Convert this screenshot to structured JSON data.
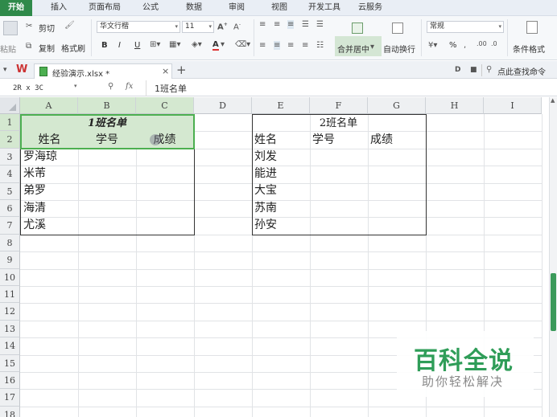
{
  "menu": {
    "items": [
      "开始",
      "插入",
      "页面布局",
      "公式",
      "数据",
      "审阅",
      "视图",
      "开发工具",
      "云服务"
    ],
    "active_index": 0
  },
  "ribbon": {
    "paste": "粘贴",
    "cut": "剪切",
    "copy": "复制",
    "format_painter": "格式刷",
    "font_name": "华文行楷",
    "font_size": "11",
    "bold": "B",
    "italic": "I",
    "underline": "U",
    "font_color_letter": "A",
    "merge_center": "合并居中",
    "wrap_text": "自动换行",
    "number_format": "常规",
    "percent": "%",
    "conditional_format": "条件格式"
  },
  "tabbar": {
    "file_name": "经验演示.xlsx *",
    "find_command": "点此查找命令",
    "new_tab": "+",
    "close": "×"
  },
  "formula_bar": {
    "name_box": "2R x 3C",
    "fx": "fx",
    "content": "1班名单"
  },
  "sheet": {
    "columns": [
      "A",
      "B",
      "C",
      "D",
      "E",
      "F",
      "G",
      "H",
      "I"
    ],
    "rows": [
      "1",
      "2",
      "3",
      "4",
      "5",
      "6",
      "7",
      "8",
      "9",
      "10",
      "11",
      "12",
      "13",
      "14",
      "15",
      "16",
      "17",
      "18"
    ],
    "class1": {
      "title": "1班名单",
      "headers": [
        "姓名",
        "学号",
        "成绩"
      ],
      "names": [
        "罗海琼",
        "米芾",
        "弟罗",
        "海清",
        "尤溪"
      ]
    },
    "class2": {
      "title": "2班名单",
      "headers": [
        "姓名",
        "学号",
        "成绩"
      ],
      "names": [
        "刘发",
        "能进",
        "大宝",
        "苏南",
        "孙安"
      ]
    }
  },
  "watermark": {
    "title": "百科全说",
    "subtitle": "助你轻松解决"
  },
  "colors": {
    "accent": "#2f8a4a",
    "selection": "#4caf50",
    "watermark": "#2f9d58"
  }
}
